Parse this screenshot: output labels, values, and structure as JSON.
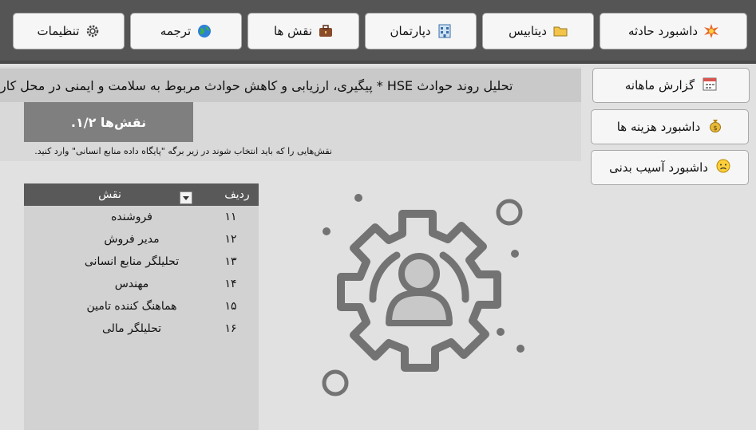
{
  "nav": {
    "buttons": [
      {
        "label": "داشبورد حادثه",
        "icon": "explosion-icon"
      },
      {
        "label": "دیتابیس",
        "icon": "folder-icon"
      },
      {
        "label": "دپارتمان",
        "icon": "building-icon"
      },
      {
        "label": "نقش ها",
        "icon": "briefcase-icon"
      },
      {
        "label": "ترجمه",
        "icon": "globe-icon"
      },
      {
        "label": "تنظیمات",
        "icon": "gear-icon"
      }
    ]
  },
  "header": {
    "title": "تحلیل روند حوادث HSE * پیگیری، ارزیابی و کاهش حوادث مربوط به سلامت و ایمنی در محل کار"
  },
  "section": {
    "label": "نقش‌ها ۱/۲.",
    "note": "نقش‌هایی را که باید انتخاب شوند در زیر برگه \"پایگاه داده منابع انسانی\" وارد کنید."
  },
  "sidebar": {
    "buttons": [
      {
        "label": "گزارش ماهانه",
        "icon": "calendar-icon"
      },
      {
        "label": "داشبورد هزینه ها",
        "icon": "money-bag-icon"
      },
      {
        "label": "داشبورد آسیب بدنی",
        "icon": "worried-face-icon"
      }
    ]
  },
  "table": {
    "headers": {
      "index": "ردیف",
      "role": "نقش"
    },
    "rows": [
      {
        "index": "۱۱",
        "role": "فروشنده"
      },
      {
        "index": "۱۲",
        "role": "مدیر فروش"
      },
      {
        "index": "۱۳",
        "role": "تحلیلگر منابع انسانی"
      },
      {
        "index": "۱۴",
        "role": "مهندس"
      },
      {
        "index": "۱۵",
        "role": "هماهنگ کننده تامین"
      },
      {
        "index": "۱۶",
        "role": "تحلیلگر مالی"
      }
    ]
  },
  "illustration": {
    "icon": "gear-person-icon"
  },
  "colors": {
    "topbar": "#555555",
    "section": "#7f7f7f",
    "table_header": "#595959",
    "gear": "#737373"
  }
}
